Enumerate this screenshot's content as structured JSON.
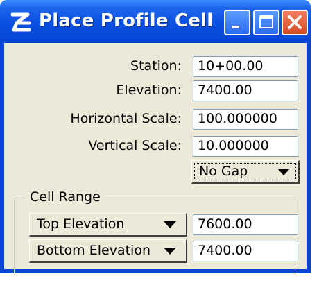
{
  "window": {
    "title": "Place Profile Cell",
    "buttons": {
      "minimize": "minimize-icon",
      "maximize": "maximize-icon",
      "close": "close-icon"
    },
    "colors": {
      "titlebar": "#0a4fe0",
      "client": "#ece9d8",
      "close_button": "#d44a24"
    }
  },
  "form": {
    "station": {
      "label": "Station:",
      "value": "10+00.00"
    },
    "elevation": {
      "label": "Elevation:",
      "value": "7400.00"
    },
    "horizontal_scale": {
      "label": "Horizontal Scale:",
      "value": "100.000000"
    },
    "vertical_scale": {
      "label": "Vertical Scale:",
      "value": "10.000000"
    },
    "gap_option": {
      "selected": "No Gap"
    }
  },
  "cell_range": {
    "title": "Cell Range",
    "top": {
      "option": "Top Elevation",
      "value": "7600.00"
    },
    "bottom": {
      "option": "Bottom Elevation",
      "value": "7400.00"
    }
  }
}
